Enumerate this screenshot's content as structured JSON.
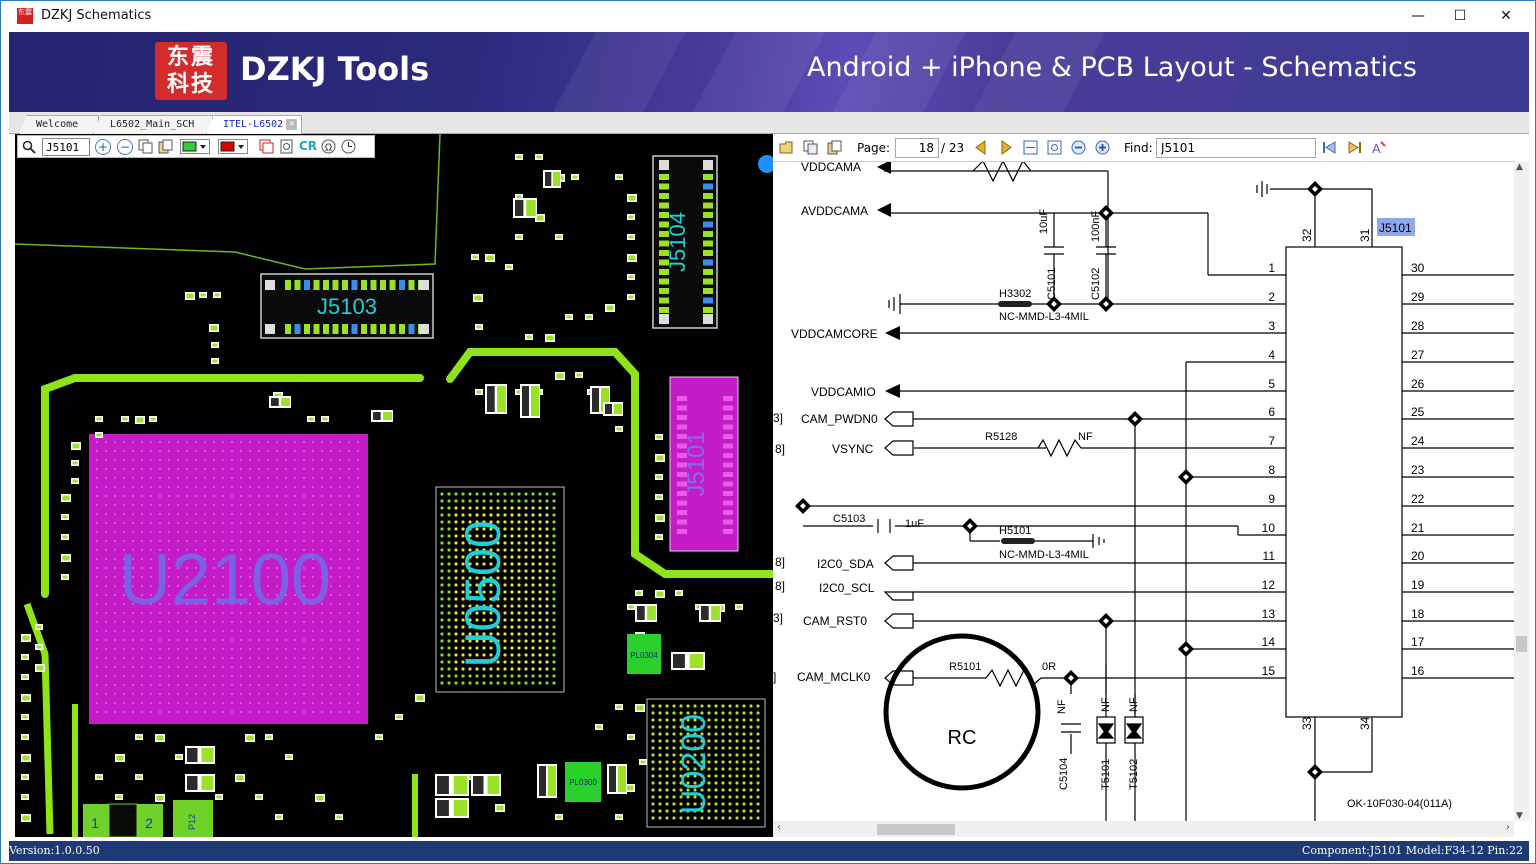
{
  "window": {
    "title": "DZKJ Schematics",
    "icon_text": "东震",
    "controls": {
      "minimize": "—",
      "maximize": "☐",
      "close": "✕"
    }
  },
  "banner": {
    "logo_text": "东震\n科技",
    "brand": "DZKJ Tools",
    "tagline": "Android + iPhone & PCB Layout - Schematics"
  },
  "tabs": [
    {
      "label": "Welcome",
      "active": false
    },
    {
      "label": "L6502_Main_SCH",
      "active": false
    },
    {
      "label": "ITEL-L6502",
      "active": true,
      "closable": true
    }
  ],
  "pcb_toolbar": {
    "search_value": "J5101",
    "cr_label": "CR",
    "fill_color": "#33cc33",
    "line_color": "#dd0000"
  },
  "pcb": {
    "components": {
      "u2100": "U2100",
      "u0500": "U0500",
      "u0200": "U0200",
      "j5103": "J5103",
      "j5104": "J5104",
      "j5101": "J5101",
      "pl0304": "PL0304",
      "pl0300": "PL0300",
      "pad1": "1",
      "pad2": "2",
      "p12": "P12"
    },
    "colors": {
      "board": "#000000",
      "trace": "#8fe31a",
      "ic_highlight": "#c41cc7",
      "pad": "#9be12a"
    }
  },
  "schematic_toolbar": {
    "page_label": "Page:",
    "page_current": "18",
    "page_total": "/ 23",
    "find_label": "Find:",
    "find_value": "J5101"
  },
  "schematic": {
    "connector": {
      "ref": "J5101",
      "part": "OK-10F030-04(011A)",
      "left_pins": [
        "1",
        "2",
        "3",
        "4",
        "5",
        "6",
        "7",
        "8",
        "9",
        "10",
        "11",
        "12",
        "13",
        "14",
        "15"
      ],
      "right_pins": [
        "30",
        "29",
        "28",
        "27",
        "26",
        "25",
        "24",
        "23",
        "22",
        "21",
        "20",
        "19",
        "18",
        "17",
        "16"
      ],
      "top_pins": [
        "32",
        "31"
      ],
      "bottom_pins": [
        "33",
        "34"
      ]
    },
    "nets": {
      "vddcama": "VDDCAMA",
      "avddcama": "AVDDCAMA",
      "vddcamcore": "VDDCAMCORE",
      "vddcamio": "VDDCAMIO",
      "cam_pwdn0": "CAM_PWDN0",
      "vsync": "VSYNC",
      "i2c0_sda": "I2C0_SDA",
      "i2c0_scl": "I2C0_SCL",
      "cam_rst0": "CAM_RST0",
      "cam_mclk0": "CAM_MCLK0"
    },
    "parts": {
      "c5101": "C5101",
      "c5101_val": "10uF",
      "c5102": "C5102",
      "c5102_val": "100nF",
      "h3302": "H3302",
      "h3302_val": "NC-MMD-L3-4MIL",
      "r5128": "R5128",
      "r5128_val": "NF",
      "c5103": "C5103",
      "c5103_val": "1uF",
      "h5101": "H5101",
      "h5101_val": "NC-MMD-L3-4MIL",
      "r5101": "R5101",
      "r5101_val": "0R",
      "c5104": "C5104",
      "c5104_val": "NF",
      "t5101": "T5101",
      "t5102": "T5102",
      "t_nf1": "NF",
      "t_nf2": "NF"
    },
    "offpage_refs": [
      "3]",
      "8]",
      "8]",
      "8]",
      "3]",
      "]"
    ],
    "annotation": "RC"
  },
  "statusbar": {
    "version": "Version:1.0.0.50",
    "component_info": "Component:J5101 Model:F34-12 Pin:22"
  }
}
